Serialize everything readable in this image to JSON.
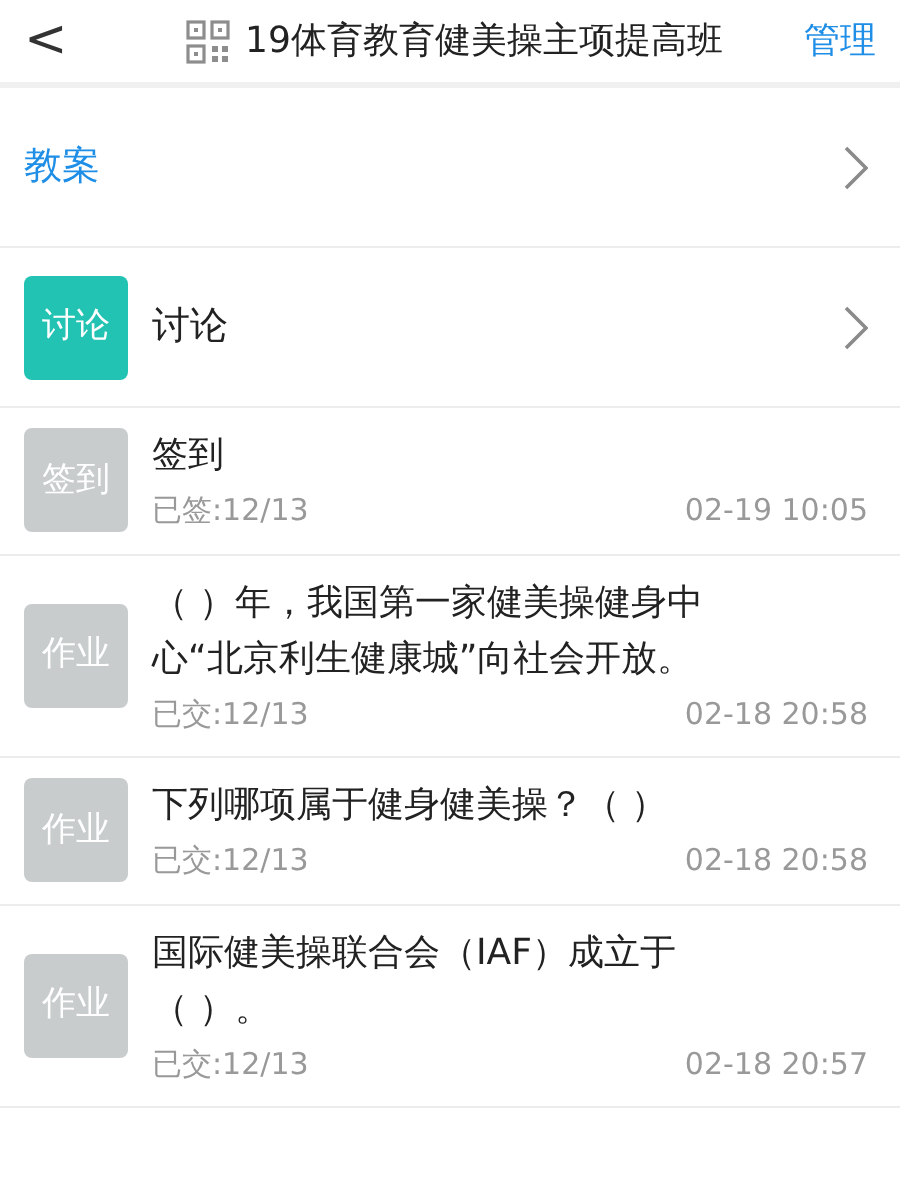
{
  "header": {
    "back": "<",
    "title": "19体育教育健美操主项提高班",
    "action": "管理"
  },
  "items": [
    {
      "kind": "link",
      "title": "教案"
    },
    {
      "kind": "badge_link",
      "badge": "讨论",
      "color": "#22c3b3",
      "title": "讨论"
    },
    {
      "kind": "activity",
      "badge": "签到",
      "color": "#c9cccd",
      "title": "签到",
      "status": "已签:12/13",
      "time": "02-19 10:05"
    },
    {
      "kind": "activity",
      "badge": "作业",
      "color": "#c9cccd",
      "title": "（ ）年，我国第一家健美操健身中心“北京利生健康城”向社会开放。",
      "status": "已交:12/13",
      "time": "02-18 20:58"
    },
    {
      "kind": "activity",
      "badge": "作业",
      "color": "#c9cccd",
      "title": "下列哪项属于健身健美操？（ ）",
      "status": "已交:12/13",
      "time": "02-18 20:58"
    },
    {
      "kind": "activity",
      "badge": "作业",
      "color": "#c9cccd",
      "title": "国际健美操联合会（IAF）成立于（ ）。",
      "status": "已交:12/13",
      "time": "02-18 20:57"
    }
  ]
}
